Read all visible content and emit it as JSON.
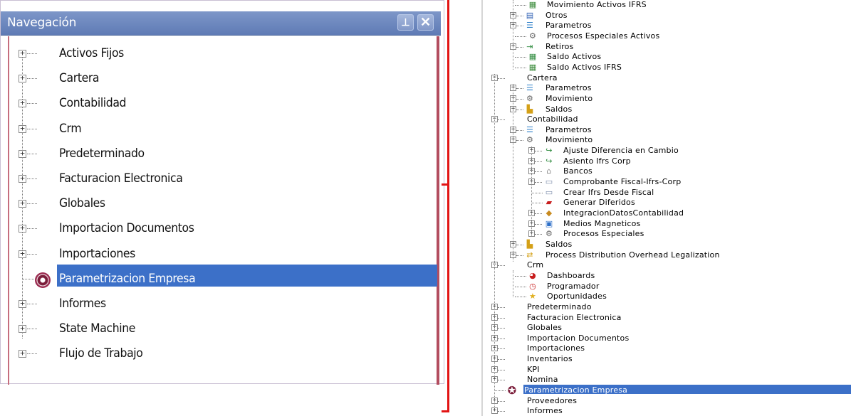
{
  "left_panel": {
    "title": "Navegación",
    "buttons": {
      "pin_icon": "pin-icon",
      "close_icon": "close-icon"
    },
    "items": [
      {
        "label": "Activos Fijos"
      },
      {
        "label": "Cartera"
      },
      {
        "label": "Contabilidad"
      },
      {
        "label": "Crm"
      },
      {
        "label": "Predeterminado"
      },
      {
        "label": "Facturacion Electronica"
      },
      {
        "label": "Globales"
      },
      {
        "label": "Importacion Documentos"
      },
      {
        "label": "Importaciones"
      },
      {
        "label": "Parametrizacion Empresa",
        "selected": true,
        "icon": "gear-icon"
      },
      {
        "label": "Informes"
      },
      {
        "label": "State Machine"
      },
      {
        "label": "Flujo de Trabajo"
      }
    ],
    "colors": {
      "selection": "#3c70c8",
      "title_bar": "#6f89c0"
    }
  },
  "bracket_color": "#e21414",
  "right_tree": {
    "rows": [
      {
        "label": "Movimiento Activos IFRS",
        "level": 2,
        "icon": "grid-chart-icon"
      },
      {
        "label": "Otros",
        "level": 1,
        "icon": "table-icon"
      },
      {
        "label": "Parametros",
        "level": 1,
        "icon": "settings-list-icon"
      },
      {
        "label": "Procesos Especiales Activos",
        "level": 2,
        "icon": "gear-icon"
      },
      {
        "label": "Retiros",
        "level": 1,
        "icon": "exit-arrow-icon"
      },
      {
        "label": "Saldo Activos",
        "level": 2,
        "icon": "grid-icon"
      },
      {
        "label": "Saldo Activos IFRS",
        "level": 2,
        "icon": "grid-chart-icon"
      },
      {
        "label": "Cartera",
        "level": 0
      },
      {
        "label": "Parametros",
        "level": 1,
        "icon": "settings-list-icon"
      },
      {
        "label": "Movimiento",
        "level": 1,
        "icon": "gear-icon"
      },
      {
        "label": "Saldos",
        "level": 1,
        "icon": "balance-icon"
      },
      {
        "label": "Contabilidad",
        "level": 0
      },
      {
        "label": "Parametros",
        "level": 1,
        "icon": "settings-list-icon"
      },
      {
        "label": "Movimiento",
        "level": 1,
        "icon": "gear-icon"
      },
      {
        "label": "Ajuste Diferencia en Cambio",
        "level": 2,
        "icon": "green-arrow-icon"
      },
      {
        "label": "Asiento Ifrs Corp",
        "level": 2,
        "icon": "green-arrow-icon"
      },
      {
        "label": "Bancos",
        "level": 2,
        "icon": "bank-icon"
      },
      {
        "label": "Comprobante Fiscal-Ifrs-Corp",
        "level": 2,
        "icon": "document-icon"
      },
      {
        "label": "Crear Ifrs Desde Fiscal",
        "level": 3,
        "icon": "document-icon"
      },
      {
        "label": "Generar Diferidos",
        "level": 3,
        "icon": "red-folder-icon"
      },
      {
        "label": "IntegracionDatosContabilidad",
        "level": 2,
        "icon": "integration-icon"
      },
      {
        "label": "Medios Magneticos",
        "level": 2,
        "icon": "monitor-icon"
      },
      {
        "label": "Procesos Especiales",
        "level": 2,
        "icon": "gear-icon"
      },
      {
        "label": "Saldos",
        "level": 1,
        "icon": "balance-icon"
      },
      {
        "label": "Process Distribution Overhead Legalization",
        "level": 1,
        "icon": "distribution-icon"
      },
      {
        "label": "Crm",
        "level": 0
      },
      {
        "label": "Dashboards",
        "level": 2,
        "icon": "pie-chart-icon"
      },
      {
        "label": "Programador",
        "level": 2,
        "icon": "clock-icon"
      },
      {
        "label": "Oportunidades",
        "level": 2,
        "icon": "star-icon"
      },
      {
        "label": "Predeterminado",
        "level": 0
      },
      {
        "label": "Facturacion Electronica",
        "level": 0
      },
      {
        "label": "Globales",
        "level": 0
      },
      {
        "label": "Importacion Documentos",
        "level": 0
      },
      {
        "label": "Importaciones",
        "level": 0
      },
      {
        "label": "Inventarios",
        "level": 0
      },
      {
        "label": "KPI",
        "level": 0
      },
      {
        "label": "Nomina",
        "level": 0
      },
      {
        "label": "Parametrizacion Empresa",
        "level": 0,
        "selected": true,
        "icon": "gear-icon"
      },
      {
        "label": "Proveedores",
        "level": 0
      },
      {
        "label": "Informes",
        "level": 0
      }
    ]
  }
}
